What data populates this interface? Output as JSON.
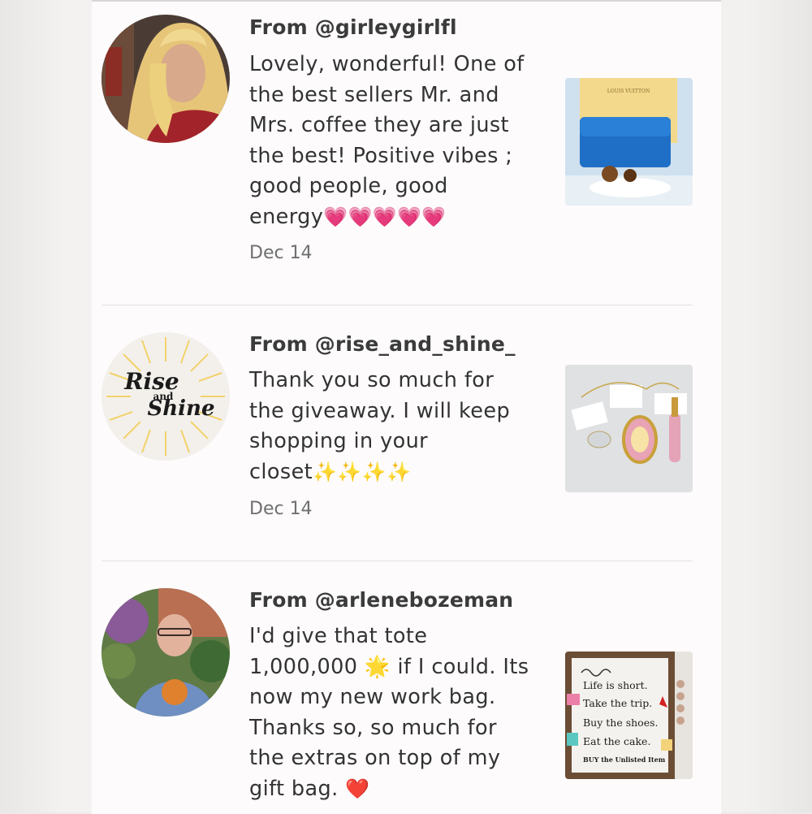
{
  "reviews": [
    {
      "from": "From @girleygirlfl",
      "lines": [
        "Lovely, wonderful! One of",
        "the best sellers Mr. and",
        "Mrs. coffee they are just",
        "the best! Positive vibes ;",
        "good people, good",
        "energy"
      ],
      "emoji_tail": "💗💗💗💗💗",
      "date": "Dec 14",
      "avatar": "user-photo-blonde-woman",
      "thumb": "louis-vuitton-blue-wallet",
      "thumb_label": "LOUIS VUITTON"
    },
    {
      "from": "From @rise_and_shine_",
      "lines": [
        "Thank you so much for",
        "the giveaway. I will keep",
        "shopping in your",
        "closet"
      ],
      "emoji_tail": "✨✨✨✨",
      "date": "Dec 14",
      "avatar_logo": {
        "line1": "Rise",
        "line2": "and",
        "line3": "Shine"
      },
      "thumb": "christmas-ornaments"
    },
    {
      "from": "From @arlenebozeman",
      "lines": [
        "I'd give that tote",
        "1,000,000 🌟 if I could. Its",
        "now my new work bag.",
        "Thanks so, so much for",
        "the extras on top of my",
        "gift bag."
      ],
      "emoji_tail": "❤️",
      "avatar": "user-photo-woman-glasses",
      "thumb": "wood-sign",
      "sign_lines": [
        "Life is short.",
        "Take the trip.",
        "Buy the shoes.",
        "Eat the cake.",
        "BUY the Unlisted Item"
      ]
    }
  ],
  "colors": {
    "panel": "#fdfbfc",
    "text": "#333333",
    "date": "#6f6f6f"
  }
}
